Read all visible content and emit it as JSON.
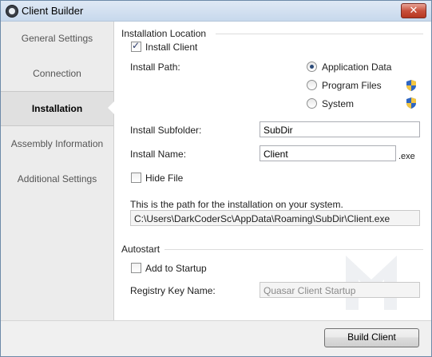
{
  "window": {
    "title": "Client Builder",
    "close_glyph": "✕"
  },
  "sidebar": {
    "items": [
      {
        "label": "General Settings",
        "active": false
      },
      {
        "label": "Connection",
        "active": false
      },
      {
        "label": "Installation",
        "active": true
      },
      {
        "label": "Assembly Information",
        "active": false
      },
      {
        "label": "Additional Settings",
        "active": false
      }
    ]
  },
  "installation": {
    "section_title": "Installation Location",
    "install_client": {
      "label": "Install Client",
      "checked": true
    },
    "install_path": {
      "label": "Install Path:",
      "options": [
        {
          "label": "Application Data",
          "selected": true,
          "icon": "uac-shield-icon"
        },
        {
          "label": "Program Files",
          "selected": false,
          "icon": "uac-shield-icon"
        },
        {
          "label": "System",
          "selected": false,
          "icon": "uac-shield-icon"
        }
      ]
    },
    "subfolder": {
      "label": "Install Subfolder:",
      "value": "SubDir"
    },
    "name": {
      "label": "Install Name:",
      "value": "Client",
      "suffix": ".exe"
    },
    "hide_file": {
      "label": "Hide File",
      "checked": false
    },
    "path_info": "This is the path for the installation on your system.",
    "path_value": "C:\\Users\\DarkCoderSc\\AppData\\Roaming\\SubDir\\Client.exe"
  },
  "autostart": {
    "section_title": "Autostart",
    "add_to_startup": {
      "label": "Add to Startup",
      "checked": false
    },
    "registry_key": {
      "label": "Registry Key Name:",
      "value": "Quasar Client Startup"
    }
  },
  "footer": {
    "build_label": "Build Client"
  },
  "colors": {
    "accent": "#2b4a78",
    "titlebar": "#c7d8ec",
    "close": "#c8503c"
  }
}
